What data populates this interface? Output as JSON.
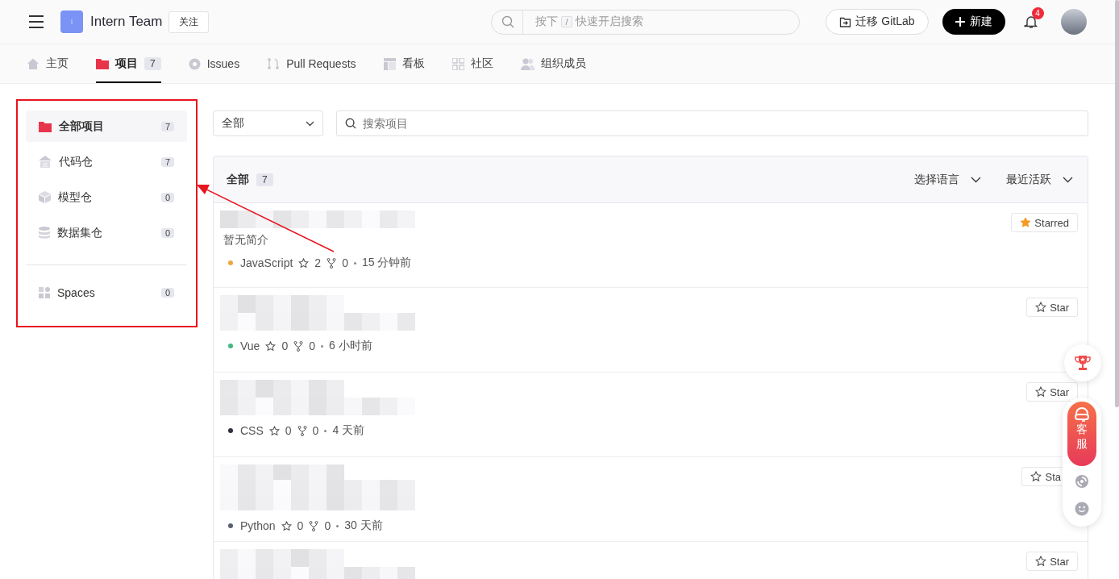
{
  "header": {
    "team_initial": "I",
    "team_name": "Intern Team",
    "follow_label": "关注",
    "search": {
      "placeholder_prefix": "按下",
      "shortcut_key": "/",
      "placeholder_suffix": "快速开启搜索"
    },
    "migrate_label": "迁移 GitLab",
    "new_label": "新建",
    "notification_count": "4"
  },
  "tabs": [
    {
      "kind": "home",
      "label": "主页",
      "selected": false
    },
    {
      "kind": "projects",
      "label": "项目",
      "count": "7",
      "selected": true
    },
    {
      "kind": "issues",
      "label": "Issues",
      "selected": false
    },
    {
      "kind": "pulls",
      "label": "Pull Requests",
      "selected": false
    },
    {
      "kind": "board",
      "label": "看板",
      "selected": false
    },
    {
      "kind": "community",
      "label": "社区",
      "selected": false
    },
    {
      "kind": "members",
      "label": "组织成员",
      "selected": false
    }
  ],
  "sidebar": {
    "items": [
      {
        "kind": "all",
        "label": "全部项目",
        "count": "7",
        "selected": true
      },
      {
        "kind": "code",
        "label": "代码仓",
        "count": "7",
        "selected": false
      },
      {
        "kind": "model",
        "label": "模型仓",
        "count": "0",
        "selected": false
      },
      {
        "kind": "dataset",
        "label": "数据集仓",
        "count": "0",
        "selected": false
      }
    ],
    "extra_items": [
      {
        "kind": "spaces",
        "label": "Spaces",
        "count": "0",
        "selected": false
      }
    ]
  },
  "filters": {
    "type_select": "全部",
    "search_placeholder": "搜索项目"
  },
  "list": {
    "title": "全部",
    "count": "7",
    "language_filter": "选择语言",
    "sort_filter": "最近活跃",
    "rows": [
      {
        "description": "暂无简介",
        "language": "JavaScript",
        "color": "#f0a541",
        "stars": "2",
        "forks": "0",
        "time": "15 分钟前",
        "starred": true,
        "star_label": "Starred"
      },
      {
        "language": "Vue",
        "color": "#42b883",
        "stars": "0",
        "forks": "0",
        "time": "6 小时前",
        "starred": false,
        "star_label": "Star"
      },
      {
        "language": "CSS",
        "color": "#2f3142",
        "stars": "0",
        "forks": "0",
        "time": "4 天前",
        "starred": false,
        "star_label": "Star"
      },
      {
        "language": "Python",
        "color": "#5b6070",
        "stars": "0",
        "forks": "0",
        "time": "30 天前",
        "starred": false,
        "star_label": "Sta"
      },
      {
        "starred": false,
        "star_label": "Star"
      }
    ]
  },
  "float_panel": {
    "service_label": [
      "客",
      "服"
    ]
  }
}
